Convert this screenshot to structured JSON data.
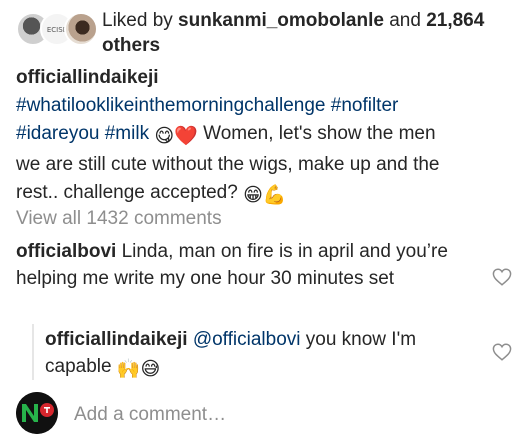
{
  "likes": {
    "prefix": "Liked by ",
    "user": "sunkanmi_omobolanle",
    "middle": " and ",
    "count": "21,864",
    "suffix": "others",
    "avatar2_text": "ECISE"
  },
  "caption": {
    "user": "officiallindaikeji",
    "tags1": "#whatilooklikeinthemorningchallenge #nofilter",
    "tags2": "#idareyou #milk",
    "text1": "Women, let's show the men",
    "text2": "we are still cute without the wigs, make up and the",
    "text3": "rest.. challenge accepted?",
    "emoji1": "😋",
    "emoji2": "❤️",
    "emoji3": "😁",
    "emoji4": "💪"
  },
  "view_all": "View all 1432 comments",
  "comment1": {
    "user": "officialbovi",
    "text": "Linda, man on fire is in april and you’re helping me write my one hour 30 minutes set"
  },
  "comment2": {
    "user": "officiallindaikeji",
    "mention": "@officialbovi",
    "text": "you know I'm capable",
    "emoji1": "🙌",
    "emoji2": "😅"
  },
  "footer": {
    "placeholder": "Add a comment…"
  },
  "colors": {
    "text": "#262626",
    "hashtag": "#003569",
    "muted": "#8e8e8e",
    "logo_green": "#27b34b",
    "logo_red": "#d6262d"
  }
}
